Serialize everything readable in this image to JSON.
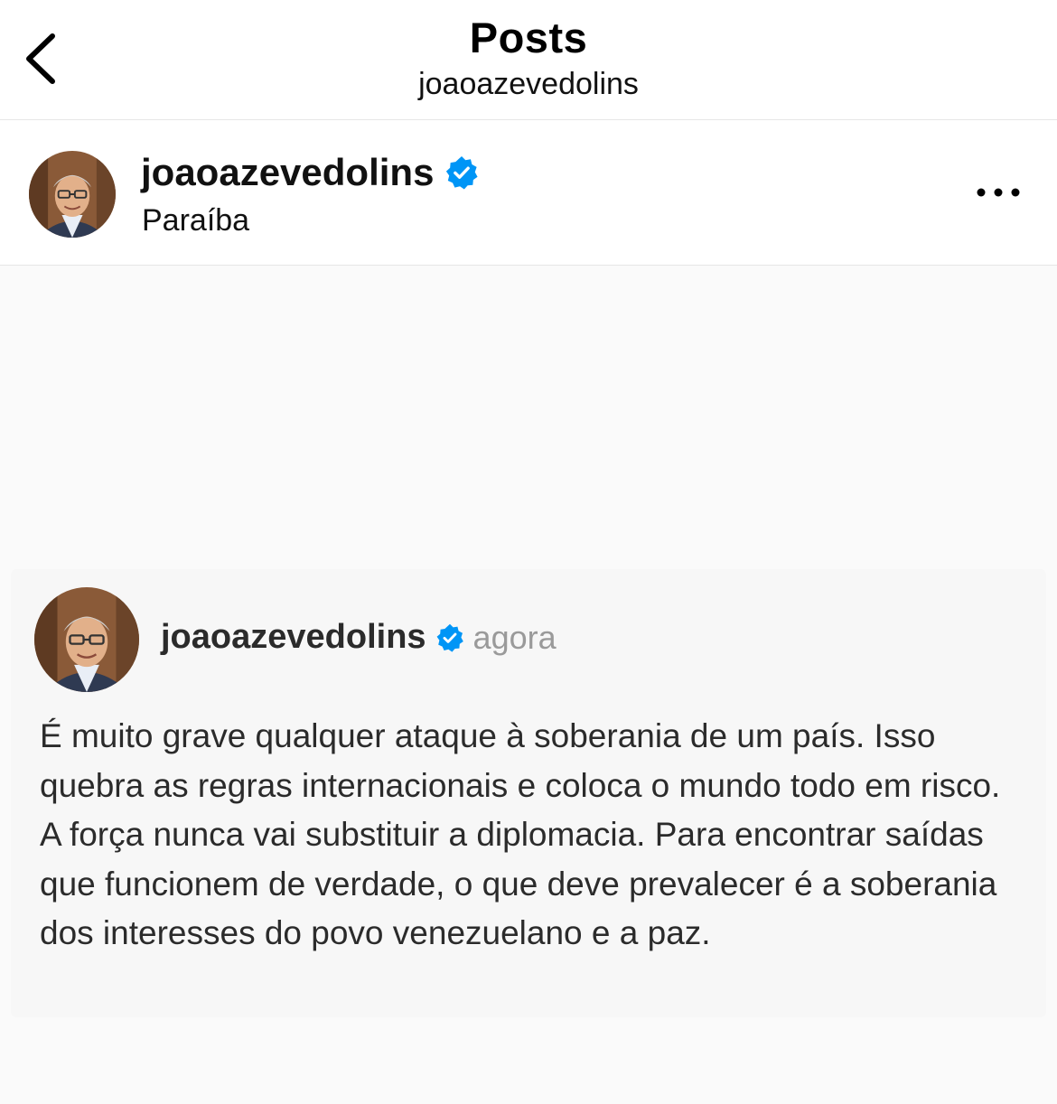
{
  "nav": {
    "title": "Posts",
    "subtitle": "joaoazevedolins",
    "back_icon": "chevron-left-icon"
  },
  "post": {
    "author": {
      "username": "joaoazevedolins",
      "verified": true,
      "location": "Paraíba"
    },
    "more_icon": "ellipsis-icon",
    "quote_card": {
      "username": "joaoazevedolins",
      "verified": true,
      "time": "agora",
      "text": "É muito grave qualquer ataque à soberania de um país. Isso quebra as regras internacionais e coloca o mundo todo em risco. A força nunca vai substituir a diplomacia. Para encontrar saídas que funcionem de verdade, o que deve prevalecer é a soberania dos interesses do povo venezuelano e a paz."
    }
  },
  "colors": {
    "verified_badge": "#0095f6",
    "secondary_text": "#9a9a9a",
    "card_background": "#f7f7f7",
    "media_background": "#fafafa"
  }
}
